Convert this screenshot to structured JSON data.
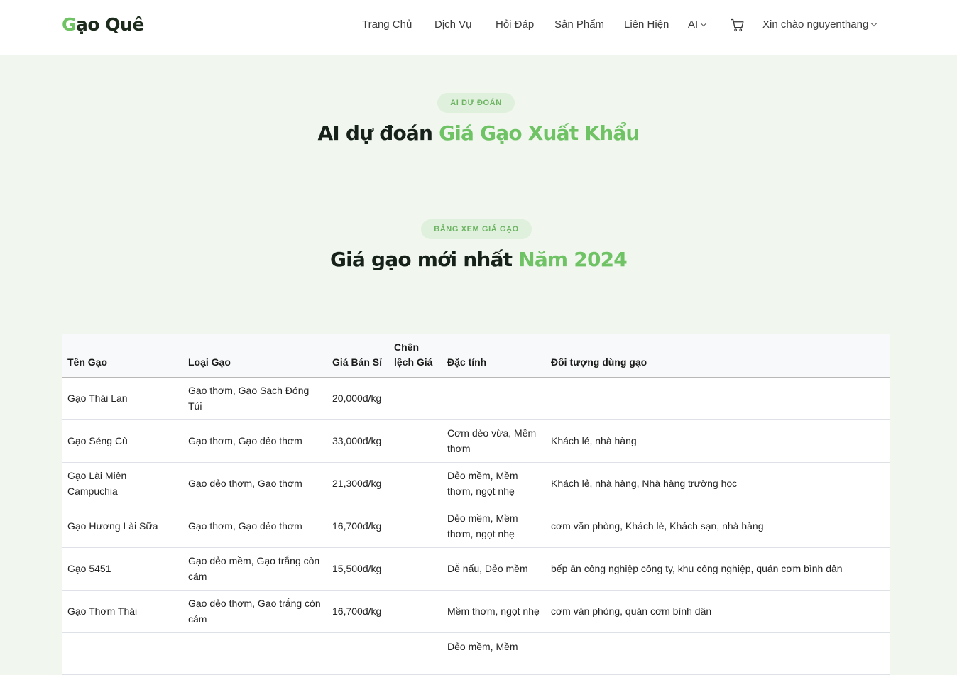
{
  "header": {
    "logo_first": "G",
    "logo_rest": "ạo Quê",
    "nav": [
      "Trang Chủ",
      "Dịch Vụ",
      "Hỏi Đáp",
      "Sản Phẩm",
      "Liên Hiện",
      "AI"
    ],
    "user_greeting": "Xin chào nguyenthang",
    "cart_icon": "cart-icon"
  },
  "section_ai": {
    "badge": "AI DỰ ĐOÁN",
    "title_plain": "AI dự đoán ",
    "title_highlight": "Giá Gạo Xuất Khẩu"
  },
  "section_table": {
    "badge": "BẢNG XEM GIÁ GẠO",
    "title_plain": "Giá gạo mới nhất ",
    "title_highlight": "Năm 2024"
  },
  "table": {
    "columns": [
      "Tên Gạo",
      "Loại Gạo",
      "Giá Bán Sỉ",
      "Chên lệch Giá",
      "Đặc tính",
      "Đối tượng dùng gạo"
    ],
    "rows": [
      [
        "Gạo Thái Lan",
        "Gạo thơm, Gạo Sạch Đóng Túi",
        "20,000đ/kg",
        "",
        "",
        ""
      ],
      [
        "Gạo Séng Cù",
        "Gạo thơm, Gạo dẻo thơm",
        "33,000đ/kg",
        "",
        "Cơm dẻo vừa, Mềm thơm",
        "Khách lẻ, nhà hàng"
      ],
      [
        "Gạo Lài Miên Campuchia",
        "Gạo dẻo thơm, Gạo thơm",
        "21,300đ/kg",
        "",
        "Dẻo mềm, Mềm thơm, ngọt nhẹ",
        "Khách lẻ, nhà hàng, Nhà hàng trường học"
      ],
      [
        "Gạo Hương Lài Sữa",
        "Gạo thơm, Gạo dẻo thơm",
        "16,700đ/kg",
        "",
        "Dẻo mềm, Mềm thơm, ngọt nhẹ",
        "cơm văn phòng, Khách lẻ, Khách sạn, nhà hàng"
      ],
      [
        "Gạo 5451",
        "Gạo dẻo mềm, Gạo trắng còn cám",
        "15,500đ/kg",
        "",
        "Dễ nấu, Dẻo mềm",
        "bếp ăn công nghiệp công ty, khu công nghiệp, quán cơm bình dân"
      ],
      [
        "Gạo Thơm Thái",
        "Gạo dẻo thơm, Gạo trắng còn cám",
        "16,700đ/kg",
        "",
        "Mềm thơm, ngọt nhẹ",
        "cơm văn phòng, quán cơm bình dân"
      ],
      [
        "",
        "",
        "",
        "",
        "Dẻo mềm, Mềm",
        ""
      ]
    ]
  }
}
